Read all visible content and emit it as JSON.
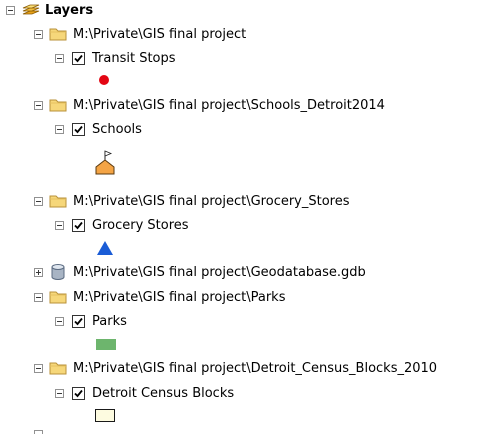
{
  "toc": {
    "root": {
      "label": "Layers"
    },
    "groups": [
      {
        "path": "M:\\Private\\GIS final project",
        "layer": "Transit Stops",
        "symbol": "red-circle",
        "color": "#e30613"
      },
      {
        "path": "M:\\Private\\GIS final project\\Schools_Detroit2014",
        "layer": "Schools",
        "symbol": "orange-school-flag",
        "color": "#f4a445"
      },
      {
        "path": "M:\\Private\\GIS final project\\Grocery_Stores",
        "layer": "Grocery Stores",
        "symbol": "blue-triangle",
        "color": "#1a5cd6"
      },
      {
        "path": "M:\\Private\\GIS final project\\Geodatabase.gdb",
        "collapsed": true,
        "icon": "geodatabase-icon"
      },
      {
        "path": "M:\\Private\\GIS final project\\Parks",
        "layer": "Parks",
        "symbol": "green-rectangle",
        "color": "#6db56d"
      },
      {
        "path": "M:\\Private\\GIS final project\\Detroit_Census_Blocks_2010",
        "layer": "Detroit Census Blocks",
        "symbol": "cream-rectangle",
        "color": "#fdfbe0"
      }
    ]
  }
}
